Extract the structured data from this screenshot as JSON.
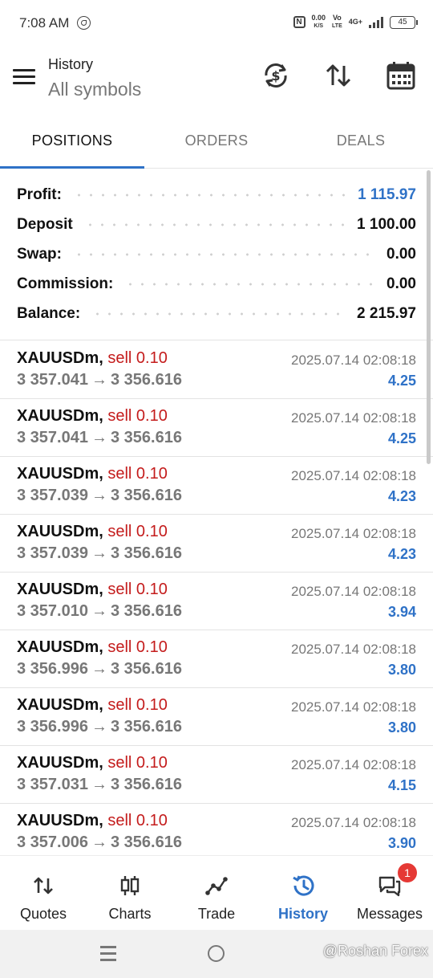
{
  "status_bar": {
    "time": "7:08 AM",
    "net_speed_value": "0.00",
    "net_speed_unit": "K/S",
    "volte_top": "Vo",
    "volte_bottom": "LTE",
    "network": "4G+",
    "battery": "45"
  },
  "header": {
    "title": "History",
    "subtitle": "All symbols",
    "icons": [
      "currency-exchange-icon",
      "sort-arrows-icon",
      "calendar-icon"
    ]
  },
  "tabs": [
    {
      "label": "POSITIONS",
      "active": true
    },
    {
      "label": "ORDERS",
      "active": false
    },
    {
      "label": "DEALS",
      "active": false
    }
  ],
  "summary": {
    "profit": {
      "label": "Profit:",
      "value": "1 115.97"
    },
    "deposit": {
      "label": "Deposit",
      "value": "1 100.00"
    },
    "swap": {
      "label": "Swap:",
      "value": "0.00"
    },
    "commission": {
      "label": "Commission:",
      "value": "0.00"
    },
    "balance": {
      "label": "Balance:",
      "value": "2 215.97"
    }
  },
  "deals": [
    {
      "symbol": "XAUUSDm,",
      "type": "sell 0.10",
      "open_price": "3 357.041",
      "close_price": "3 356.616",
      "time": "2025.07.14 02:08:18",
      "profit": "4.25"
    },
    {
      "symbol": "XAUUSDm,",
      "type": "sell 0.10",
      "open_price": "3 357.041",
      "close_price": "3 356.616",
      "time": "2025.07.14 02:08:18",
      "profit": "4.25"
    },
    {
      "symbol": "XAUUSDm,",
      "type": "sell 0.10",
      "open_price": "3 357.039",
      "close_price": "3 356.616",
      "time": "2025.07.14 02:08:18",
      "profit": "4.23"
    },
    {
      "symbol": "XAUUSDm,",
      "type": "sell 0.10",
      "open_price": "3 357.039",
      "close_price": "3 356.616",
      "time": "2025.07.14 02:08:18",
      "profit": "4.23"
    },
    {
      "symbol": "XAUUSDm,",
      "type": "sell 0.10",
      "open_price": "3 357.010",
      "close_price": "3 356.616",
      "time": "2025.07.14 02:08:18",
      "profit": "3.94"
    },
    {
      "symbol": "XAUUSDm,",
      "type": "sell 0.10",
      "open_price": "3 356.996",
      "close_price": "3 356.616",
      "time": "2025.07.14 02:08:18",
      "profit": "3.80"
    },
    {
      "symbol": "XAUUSDm,",
      "type": "sell 0.10",
      "open_price": "3 356.996",
      "close_price": "3 356.616",
      "time": "2025.07.14 02:08:18",
      "profit": "3.80"
    },
    {
      "symbol": "XAUUSDm,",
      "type": "sell 0.10",
      "open_price": "3 357.031",
      "close_price": "3 356.616",
      "time": "2025.07.14 02:08:18",
      "profit": "4.15"
    },
    {
      "symbol": "XAUUSDm,",
      "type": "sell 0.10",
      "open_price": "3 357.006",
      "close_price": "3 356.616",
      "time": "2025.07.14 02:08:18",
      "profit": "3.90"
    }
  ],
  "arrow": "→",
  "bottom_nav": [
    {
      "label": "Quotes",
      "icon": "quotes-arrows-icon",
      "active": false
    },
    {
      "label": "Charts",
      "icon": "candlestick-icon",
      "active": false
    },
    {
      "label": "Trade",
      "icon": "trend-line-icon",
      "active": false
    },
    {
      "label": "History",
      "icon": "history-clock-icon",
      "active": true
    },
    {
      "label": "Messages",
      "icon": "chat-bubbles-icon",
      "active": false,
      "badge": "1"
    }
  ],
  "watermark": "@Roshan Forex",
  "colors": {
    "accent_blue": "#2f72c7",
    "sell_red": "#c41c1c",
    "badge_red": "#e53935"
  }
}
